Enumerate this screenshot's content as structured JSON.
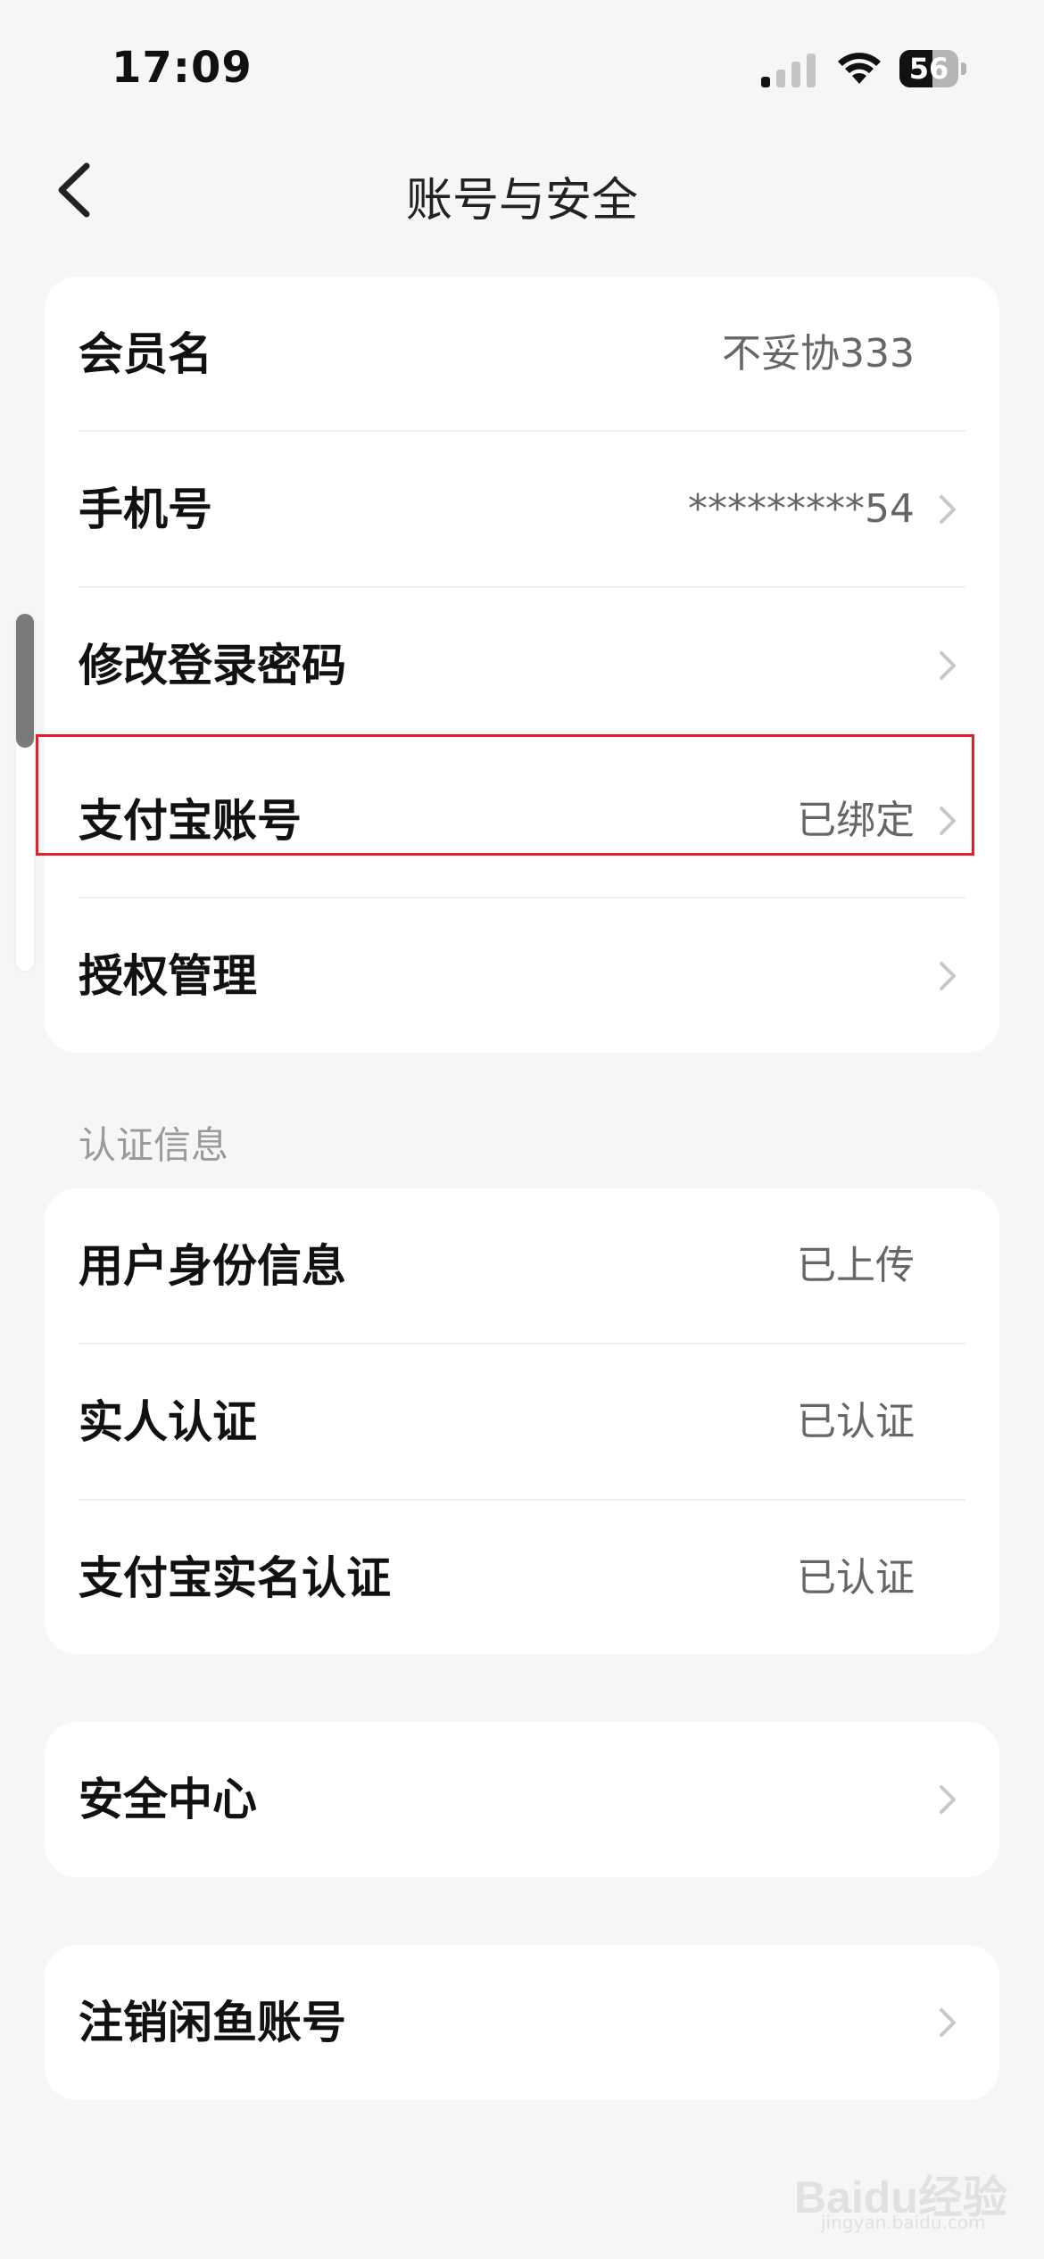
{
  "status_bar": {
    "time": "17:09",
    "battery": "56",
    "battery_level": 0.56
  },
  "nav": {
    "title": "账号与安全",
    "back_icon": "chevron-left-icon"
  },
  "account_card": {
    "rows": [
      {
        "label": "会员名",
        "value": "不妥协333",
        "chevron": false
      },
      {
        "label": "手机号",
        "value": "*********54",
        "chevron": true
      },
      {
        "label": "修改登录密码",
        "value": "",
        "chevron": true
      },
      {
        "label": "支付宝账号",
        "value": "已绑定",
        "chevron": true
      },
      {
        "label": "授权管理",
        "value": "",
        "chevron": true
      }
    ]
  },
  "verification": {
    "section_title": "认证信息",
    "rows": [
      {
        "label": "用户身份信息",
        "value": "已上传"
      },
      {
        "label": "实人认证",
        "value": "已认证"
      },
      {
        "label": "支付宝实名认证",
        "value": "已认证"
      }
    ]
  },
  "security": {
    "label": "安全中心"
  },
  "cancel": {
    "label": "注销闲鱼账号"
  },
  "watermark": {
    "text": "Baidu经验",
    "sub": "jingyan.baidu.com"
  },
  "colors": {
    "background": "#f6f6f6",
    "card": "#ffffff",
    "highlight": "#e3202a",
    "value_text": "#666666",
    "section_text": "#9a9a9a"
  }
}
